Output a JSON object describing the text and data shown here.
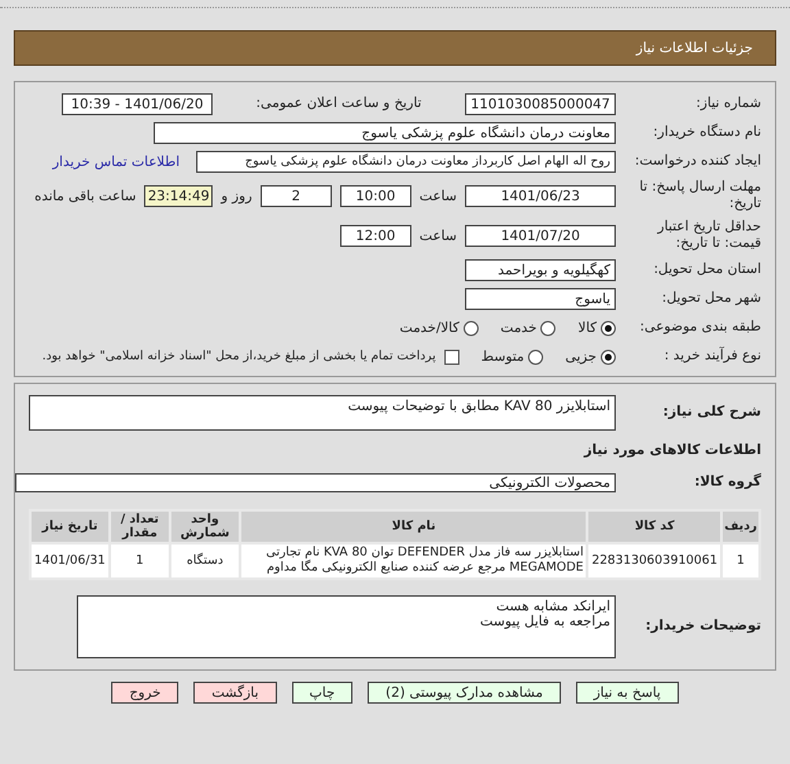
{
  "header": {
    "title": "جزئیات اطلاعات نیاز"
  },
  "details": {
    "need_number": {
      "label": "شماره نیاز:",
      "value": "1101030085000047"
    },
    "announce": {
      "label": "تاریخ و ساعت اعلان عمومی:",
      "value": "1401/06/20 - 10:39"
    },
    "buyer": {
      "label": "نام دستگاه خریدار:",
      "value": "معاونت درمان دانشگاه علوم پزشکی یاسوج"
    },
    "creator": {
      "label": "ایجاد کننده درخواست:",
      "value": "روح اله الهام اصل کاربرداز معاونت درمان دانشگاه علوم پزشکی یاسوج",
      "link": "اطلاعات تماس خریدار"
    },
    "deadline": {
      "label": "مهلت ارسال پاسخ: تا تاریخ:",
      "date": "1401/06/23",
      "time_label": "ساعت",
      "time": "10:00",
      "days": "2",
      "days_label": "روز و",
      "remaining": "23:14:49",
      "remaining_label": "ساعت باقی مانده"
    },
    "validity": {
      "label": "حداقل تاریخ اعتبار قیمت: تا تاریخ:",
      "date": "1401/07/20",
      "time_label": "ساعت",
      "time": "12:00"
    },
    "province": {
      "label": "استان محل تحویل:",
      "value": "کهگیلویه و بویراحمد"
    },
    "city": {
      "label": "شهر محل تحویل:",
      "value": "یاسوج"
    },
    "category": {
      "label": "طبقه بندی موضوعی:",
      "options": [
        {
          "label": "کالا",
          "selected": true
        },
        {
          "label": "خدمت",
          "selected": false
        },
        {
          "label": "کالا/خدمت",
          "selected": false
        }
      ]
    },
    "process": {
      "label": "نوع فرآیند خرید :",
      "options": [
        {
          "label": "جزیی",
          "selected": true
        },
        {
          "label": "متوسط",
          "selected": false
        }
      ],
      "treasury": {
        "label": "پرداخت تمام یا بخشی از مبلغ خرید،از محل \"اسناد خزانه اسلامی\" خواهد بود.",
        "checked": false
      }
    }
  },
  "need": {
    "description": {
      "label": "شرح کلی نیاز:",
      "value": "استابلایزر KAV 80 مطابق با توضیحات پیوست"
    },
    "goods_heading": "اطلاعات کالاهای مورد نیاز",
    "group": {
      "label": "گروه کالا:",
      "value": "محصولات الکترونیکی"
    },
    "table": {
      "columns": [
        "ردیف",
        "کد کالا",
        "نام کالا",
        "واحد شمارش",
        "تعداد / مقدار",
        "تاریخ نیاز"
      ],
      "rows": [
        [
          "1",
          "2283130603910061",
          "استابلایزر سه فاز مدل DEFENDER توان KVA 80 نام تجارتی MEGAMODE مرجع عرضه کننده صنایع الکترونیکی مگا مداوم",
          "دستگاه",
          "1",
          "1401/06/31"
        ]
      ]
    },
    "notes": {
      "label": "توضیحات خریدار:",
      "lines": [
        "ایرانکد مشابه هست",
        "مراجعه به فایل پیوست"
      ]
    }
  },
  "buttons": [
    {
      "label": "پاسخ به نیاز",
      "kind": "action"
    },
    {
      "label": "مشاهده مدارک پیوستی (2)",
      "kind": "action"
    },
    {
      "label": "چاپ",
      "kind": "action"
    },
    {
      "label": "بازگشت",
      "kind": "exit"
    },
    {
      "label": "خروج",
      "kind": "exit"
    }
  ]
}
